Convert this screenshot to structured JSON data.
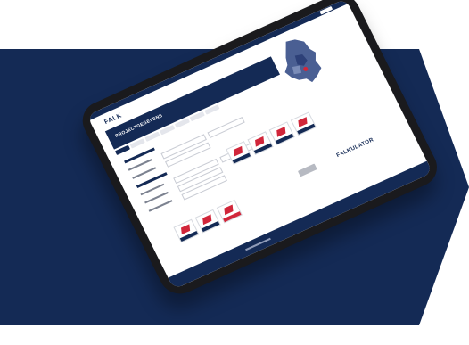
{
  "brand": {
    "logo_text": "FALK",
    "product_name": "FALKULATOR"
  },
  "hero": {
    "title": "PROJECTGEGEVENS"
  },
  "colors": {
    "navy": "#142a55",
    "accent_red": "#d1263a",
    "background": "#ffffff"
  },
  "form_rows": 8,
  "product_cards": 7,
  "icons": {
    "map": "netherlands-map-icon",
    "product": "sandwich-panel-icon"
  }
}
